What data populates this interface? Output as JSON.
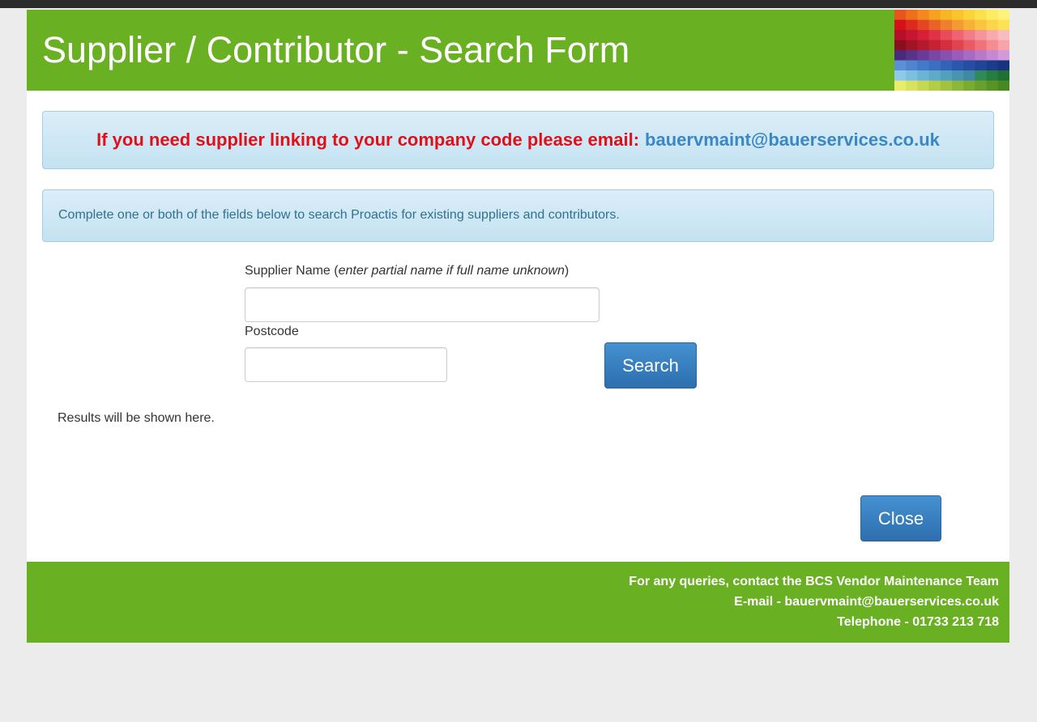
{
  "header": {
    "title": "Supplier / Contributor - Search Form",
    "brand_color": "#6ab023"
  },
  "email_alert": {
    "message": "If you need supplier linking to your company code please email:",
    "email": "bauervmaint@bauerservices.co.uk"
  },
  "info_alert": {
    "text": "Complete one or both of the fields below to search Proactis for existing suppliers and contributors."
  },
  "form": {
    "supplier_name_label": "Supplier Name (",
    "supplier_name_hint": "enter partial name if full name unknown",
    "supplier_name_label_end": ")",
    "supplier_name_value": "",
    "postcode_label": "Postcode",
    "postcode_value": "",
    "search_button": "Search"
  },
  "results_text": "Results will be shown here.",
  "close_button": "Close",
  "footer": {
    "line1": "For any queries, contact the BCS Vendor Maintenance Team",
    "line2": "E-mail - bauervmaint@bauerservices.co.uk",
    "line3": "Telephone - 01733 213 718"
  },
  "mosaic_colors": [
    [
      "#e8551c",
      "#ee6f1c",
      "#f3891e",
      "#f6a21f",
      "#f8b525",
      "#fac52c",
      "#fbd43a",
      "#fce14d",
      "#fdeb63",
      "#fef27a"
    ],
    [
      "#d4101c",
      "#dc2b1e",
      "#e44522",
      "#ea6326",
      "#ef7f2a",
      "#f39a30",
      "#f6b236",
      "#f9c53f",
      "#fbd54a",
      "#fde257"
    ],
    [
      "#b50f2a",
      "#c81530",
      "#d71f38",
      "#e03246",
      "#e84b5a",
      "#ee6470",
      "#f27d86",
      "#f5949b",
      "#f7a9ae",
      "#f9bcc0"
    ],
    [
      "#8a0f1e",
      "#a01424",
      "#b31a2b",
      "#c52234",
      "#d52f3f",
      "#e1434f",
      "#ea5a64",
      "#f0737b",
      "#f48c92",
      "#f7a4a8"
    ],
    [
      "#4a2a7a",
      "#5a3288",
      "#6a3b96",
      "#7a45a3",
      "#8a50ae",
      "#9a5cb8",
      "#a96ac1",
      "#b879c9",
      "#c689d1",
      "#d29ad8"
    ],
    [
      "#5b8fd6",
      "#4f84cf",
      "#4479c8",
      "#3a6ec0",
      "#3263b7",
      "#2b58ad",
      "#254ea2",
      "#204597",
      "#1b3c8b",
      "#17347f"
    ],
    [
      "#8ec9e8",
      "#7cbfdf",
      "#6cb4d5",
      "#5eaaca",
      "#529fbe",
      "#4894b1",
      "#3f89a3",
      "#2f8a55",
      "#277d40",
      "#1f7035"
    ],
    [
      "#e8ec6a",
      "#d8e25e",
      "#c6d853",
      "#b3cd49",
      "#a0c240",
      "#8db738",
      "#7aab31",
      "#68a02b",
      "#579425",
      "#478820"
    ]
  ]
}
